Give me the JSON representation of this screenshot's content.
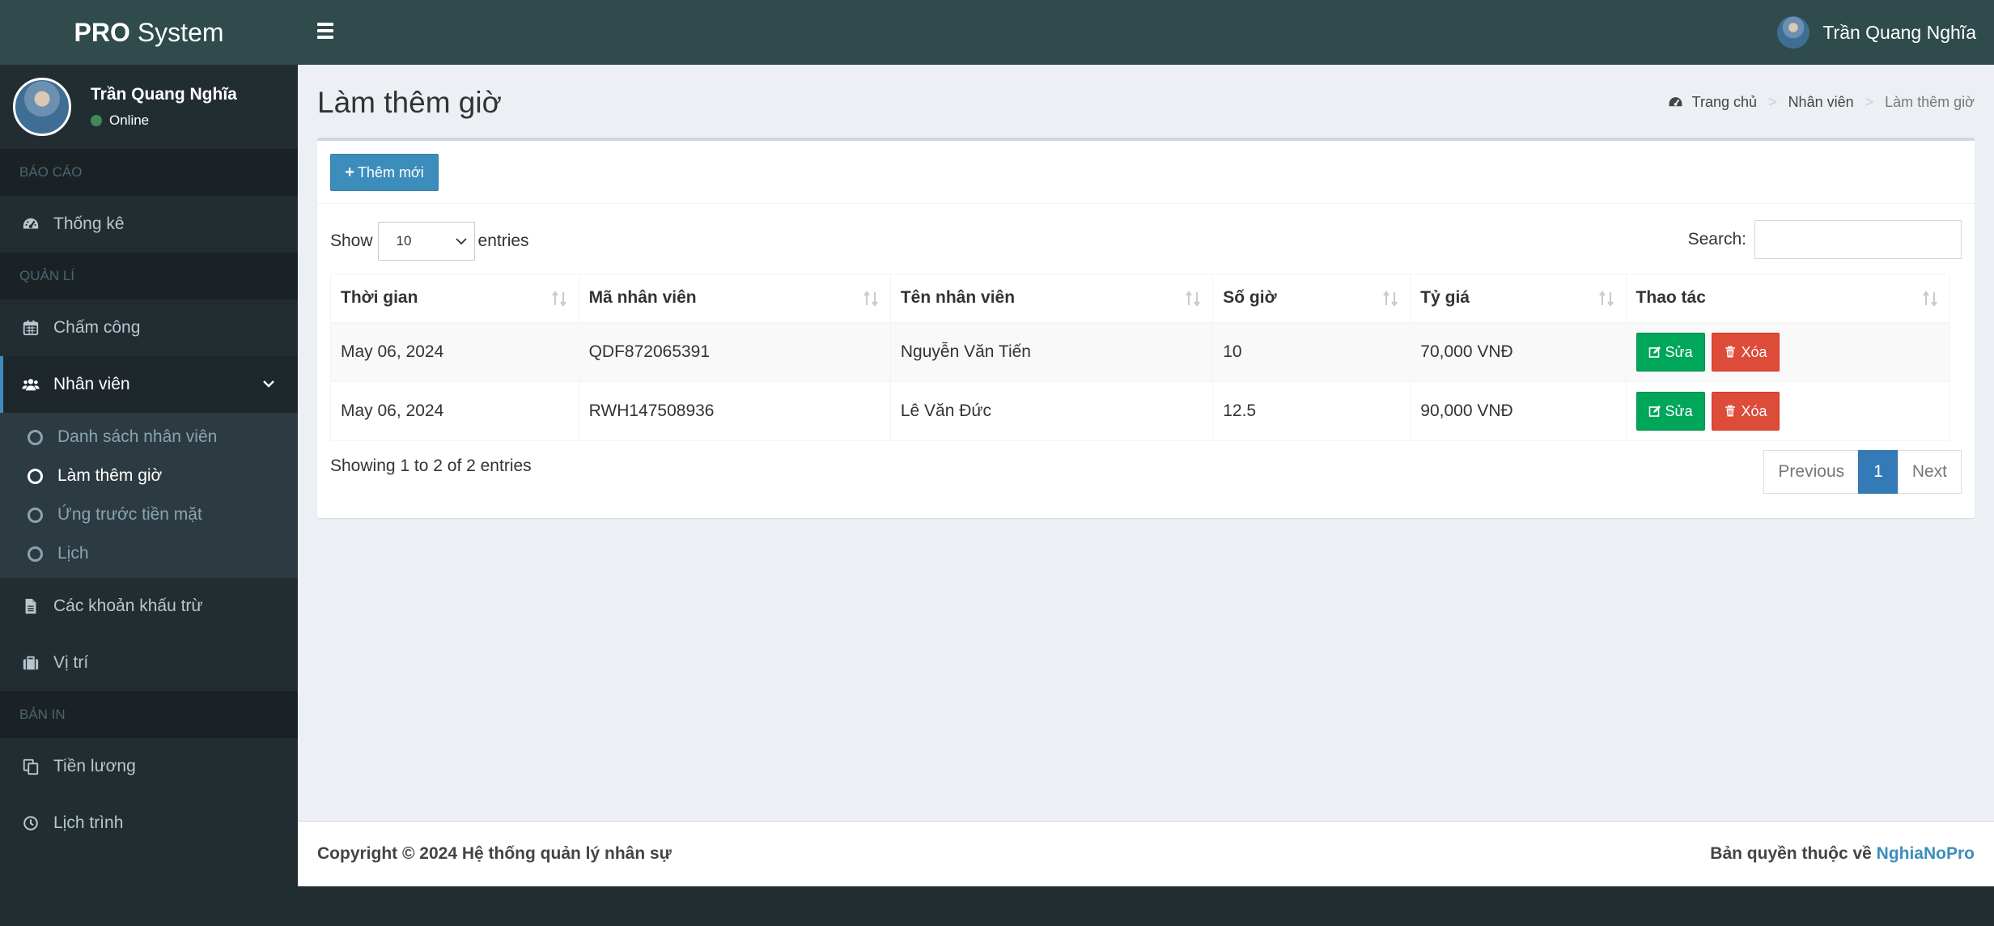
{
  "app": {
    "logo_bold": "PRO",
    "logo_rest": "System"
  },
  "user": {
    "name": "Trần Quang Nghĩa",
    "status": "Online"
  },
  "sidebar": {
    "sections": [
      "BÁO CÁO",
      "QUẢN LÍ",
      "BẢN IN"
    ],
    "items": [
      {
        "label": "Thống kê",
        "icon": "dashboard-icon"
      },
      {
        "label": "Chấm công",
        "icon": "calendar-icon"
      },
      {
        "label": "Nhân viên",
        "icon": "users-icon"
      },
      {
        "label": "Các khoản khấu trừ",
        "icon": "file-icon"
      },
      {
        "label": "Vị trí",
        "icon": "briefcase-icon"
      },
      {
        "label": "Tiền lương",
        "icon": "copy-icon"
      },
      {
        "label": "Lịch trình",
        "icon": "clock-icon"
      }
    ],
    "subitems": [
      {
        "label": "Danh sách nhân viên"
      },
      {
        "label": "Làm thêm giờ"
      },
      {
        "label": "Ứng trước tiền mặt"
      },
      {
        "label": "Lịch"
      }
    ]
  },
  "page": {
    "title": "Làm thêm giờ",
    "breadcrumb": [
      "Trang chủ",
      "Nhân viên",
      "Làm thêm giờ"
    ]
  },
  "toolbar": {
    "add_label": "Thêm mới"
  },
  "table_controls": {
    "show_label": "Show",
    "entries_label": "entries",
    "page_length": "10",
    "search_label": "Search:",
    "search_value": ""
  },
  "table": {
    "columns": [
      "Thời gian",
      "Mã nhân viên",
      "Tên nhân viên",
      "Số giờ",
      "Tỷ giá",
      "Thao tác"
    ],
    "rows": [
      [
        "May 06, 2024",
        "QDF872065391",
        "Nguyễn Văn Tiến",
        "10",
        "70,000 VNĐ"
      ],
      [
        "May 06, 2024",
        "RWH147508936",
        "Lê Văn Đức",
        "12.5",
        "90,000 VNĐ"
      ]
    ],
    "edit_label": "Sửa",
    "delete_label": "Xóa"
  },
  "pagination": {
    "info": "Showing 1 to 2 of 2 entries",
    "previous": "Previous",
    "current": "1",
    "next": "Next"
  },
  "footer": {
    "copyright": "Copyright © 2024 Hệ thống quản lý nhân sự",
    "rights_prefix": "Bản quyền thuộc về",
    "rights_link": "NghiaNoPro"
  },
  "colors": {
    "header": "#2f4b4b",
    "sidebar": "#222d32",
    "primary": "#3c8dbc",
    "success": "#00a65a",
    "danger": "#dd4b39"
  }
}
